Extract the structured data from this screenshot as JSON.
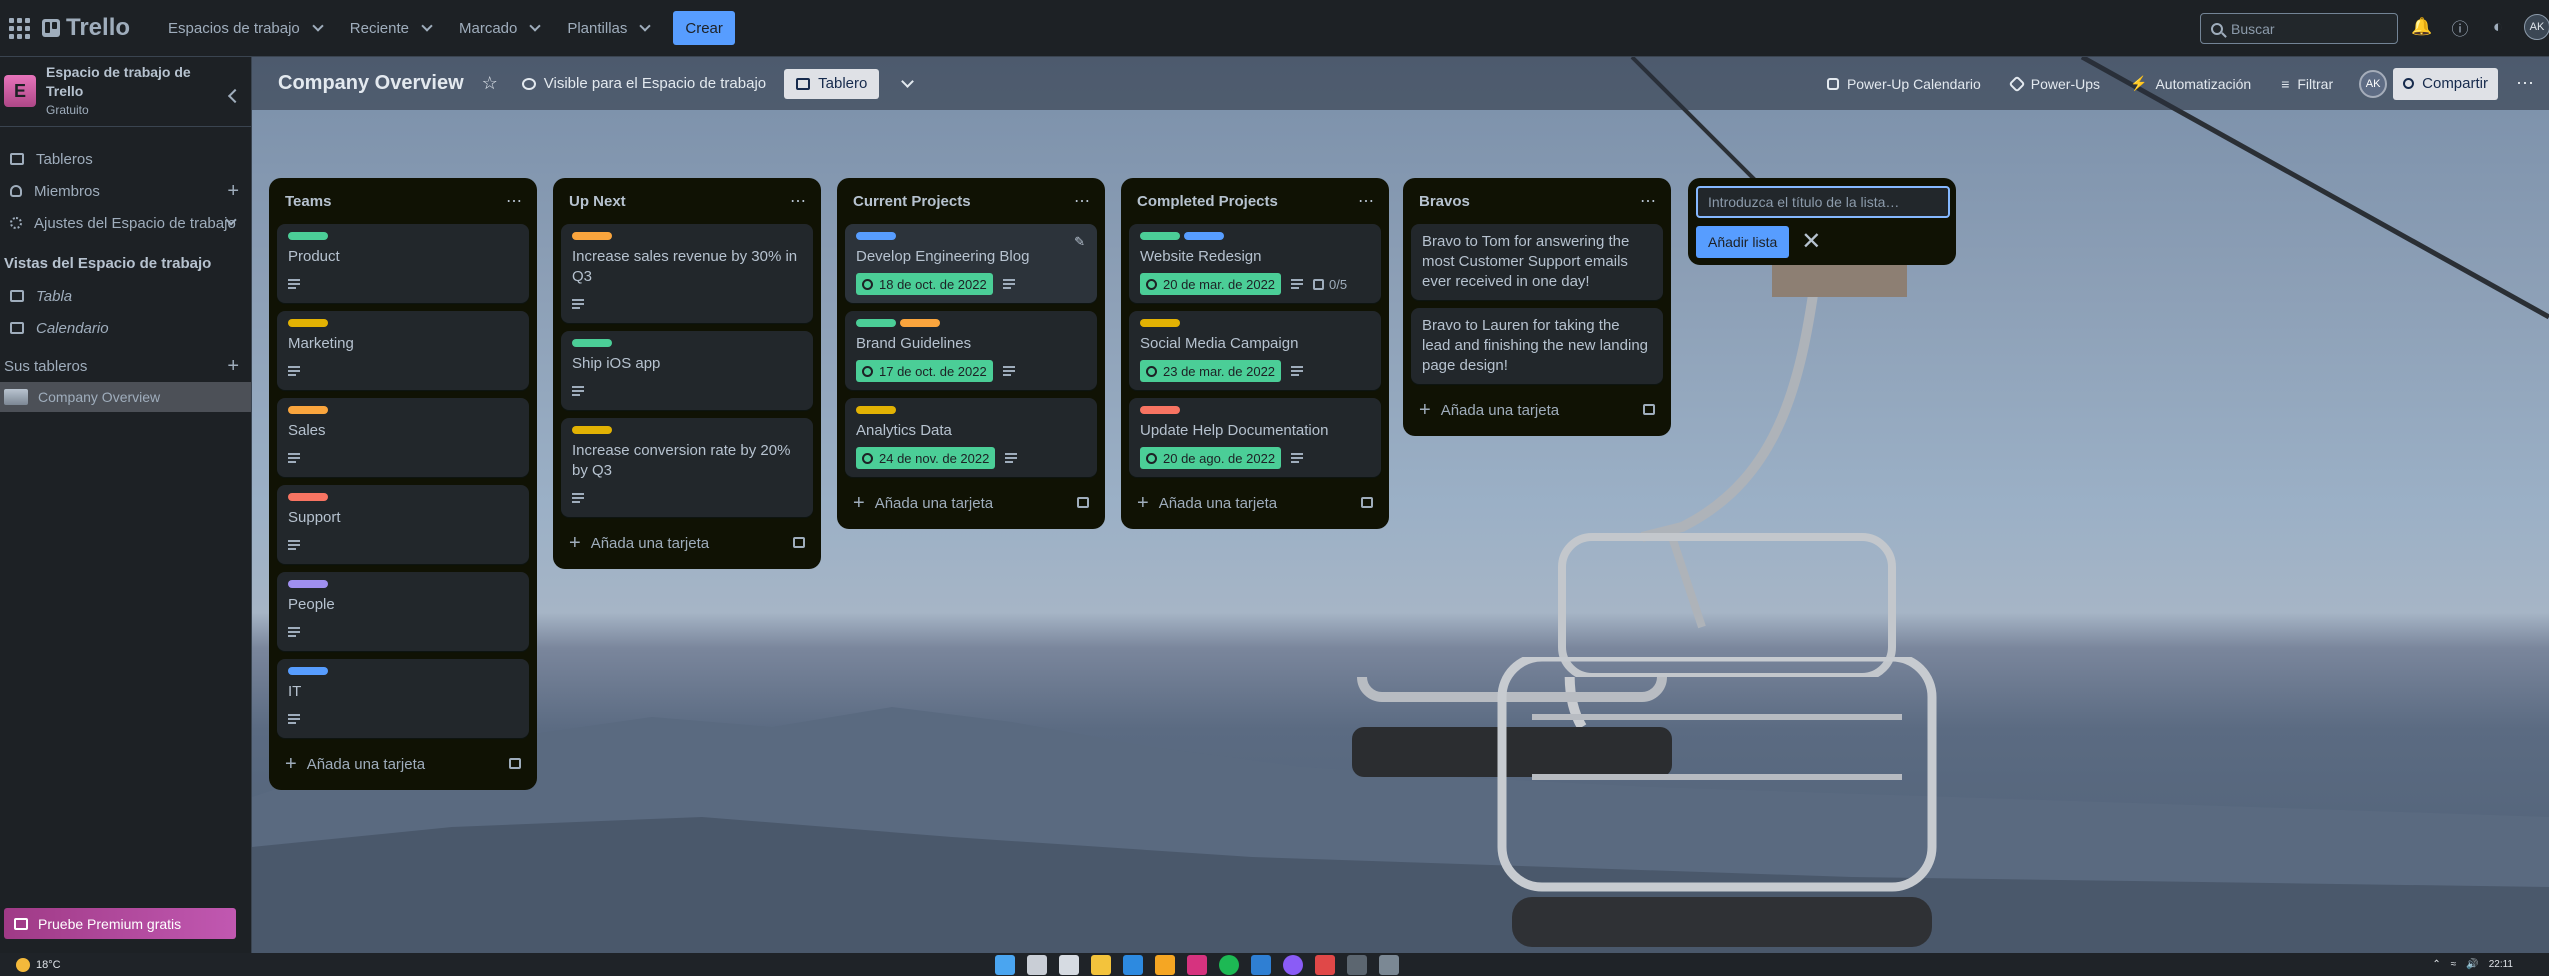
{
  "topbar": {
    "logo_text": "Trello",
    "nav": [
      "Espacios de trabajo",
      "Reciente",
      "Marcado",
      "Plantillas"
    ],
    "create_label": "Crear",
    "search_placeholder": "Buscar",
    "avatar_initials": "AK"
  },
  "sidebar": {
    "workspace_letter": "E",
    "workspace_name": "Espacio de trabajo de Trello",
    "workspace_plan": "Gratuito",
    "items": {
      "boards": "Tableros",
      "members": "Miembros",
      "settings": "Ajustes del Espacio de trabajo"
    },
    "views_heading": "Vistas del Espacio de trabajo",
    "views": [
      "Tabla",
      "Calendario"
    ],
    "your_boards_heading": "Sus tableros",
    "active_board": "Company Overview",
    "premium_label": "Pruebe Premium gratis"
  },
  "board_header": {
    "title": "Company Overview",
    "visibility": "Visible para el Espacio de trabajo",
    "view_label": "Tablero",
    "powerup_calendar": "Power-Up Calendario",
    "powerups": "Power-Ups",
    "automation": "Automatización",
    "filter": "Filtrar",
    "member_initials": "AK",
    "share": "Compartir"
  },
  "add_card_label": "Añada una tarjeta",
  "lists": [
    {
      "title": "Teams",
      "cards": [
        {
          "title": "Product",
          "labels": [
            "#4bce97"
          ],
          "desc": true
        },
        {
          "title": "Marketing",
          "labels": [
            "#e2b203"
          ],
          "desc": true
        },
        {
          "title": "Sales",
          "labels": [
            "#faa53d"
          ],
          "desc": true
        },
        {
          "title": "Support",
          "labels": [
            "#f87462"
          ],
          "desc": true
        },
        {
          "title": "People",
          "labels": [
            "#9f8fef"
          ],
          "desc": true
        },
        {
          "title": "IT",
          "labels": [
            "#579dff"
          ],
          "desc": true
        }
      ]
    },
    {
      "title": "Up Next",
      "cards": [
        {
          "title": "Increase sales revenue by 30% in Q3",
          "labels": [
            "#faa53d"
          ],
          "desc": true
        },
        {
          "title": "Ship iOS app",
          "labels": [
            "#4bce97"
          ],
          "desc": true
        },
        {
          "title": "Increase conversion rate by 20% by Q3",
          "labels": [
            "#e2b203"
          ],
          "desc": true
        }
      ]
    },
    {
      "title": "Current Projects",
      "cards": [
        {
          "title": "Develop Engineering Blog",
          "labels": [
            "#579dff"
          ],
          "due": "18 de oct. de 2022",
          "desc": true,
          "editing": true
        },
        {
          "title": "Brand Guidelines",
          "labels": [
            "#4bce97",
            "#faa53d"
          ],
          "due": "17 de oct. de 2022",
          "desc": true
        },
        {
          "title": "Analytics Data",
          "labels": [
            "#e2b203"
          ],
          "due": "24 de nov. de 2022",
          "desc": true
        }
      ]
    },
    {
      "title": "Completed Projects",
      "cards": [
        {
          "title": "Website Redesign",
          "labels": [
            "#4bce97",
            "#579dff"
          ],
          "due": "20 de mar. de 2022",
          "desc": true,
          "checklist": "0/5"
        },
        {
          "title": "Social Media Campaign",
          "labels": [
            "#e2b203"
          ],
          "due": "23 de mar. de 2022",
          "desc": true
        },
        {
          "title": "Update Help Documentation",
          "labels": [
            "#f87462"
          ],
          "due": "20 de ago. de 2022",
          "desc": true
        }
      ]
    },
    {
      "title": "Bravos",
      "cards": [
        {
          "title": "Bravo to Tom for answering the most Customer Support emails ever received in one day!",
          "labels": [],
          "desc": false
        },
        {
          "title": "Bravo to Lauren for taking the lead and finishing the new landing page design!",
          "labels": [],
          "desc": false
        }
      ]
    }
  ],
  "new_list": {
    "placeholder": "Introduzca el título de la lista…",
    "add_label": "Añadir lista"
  },
  "taskbar": {
    "temperature": "18°C",
    "time": "22:11"
  }
}
